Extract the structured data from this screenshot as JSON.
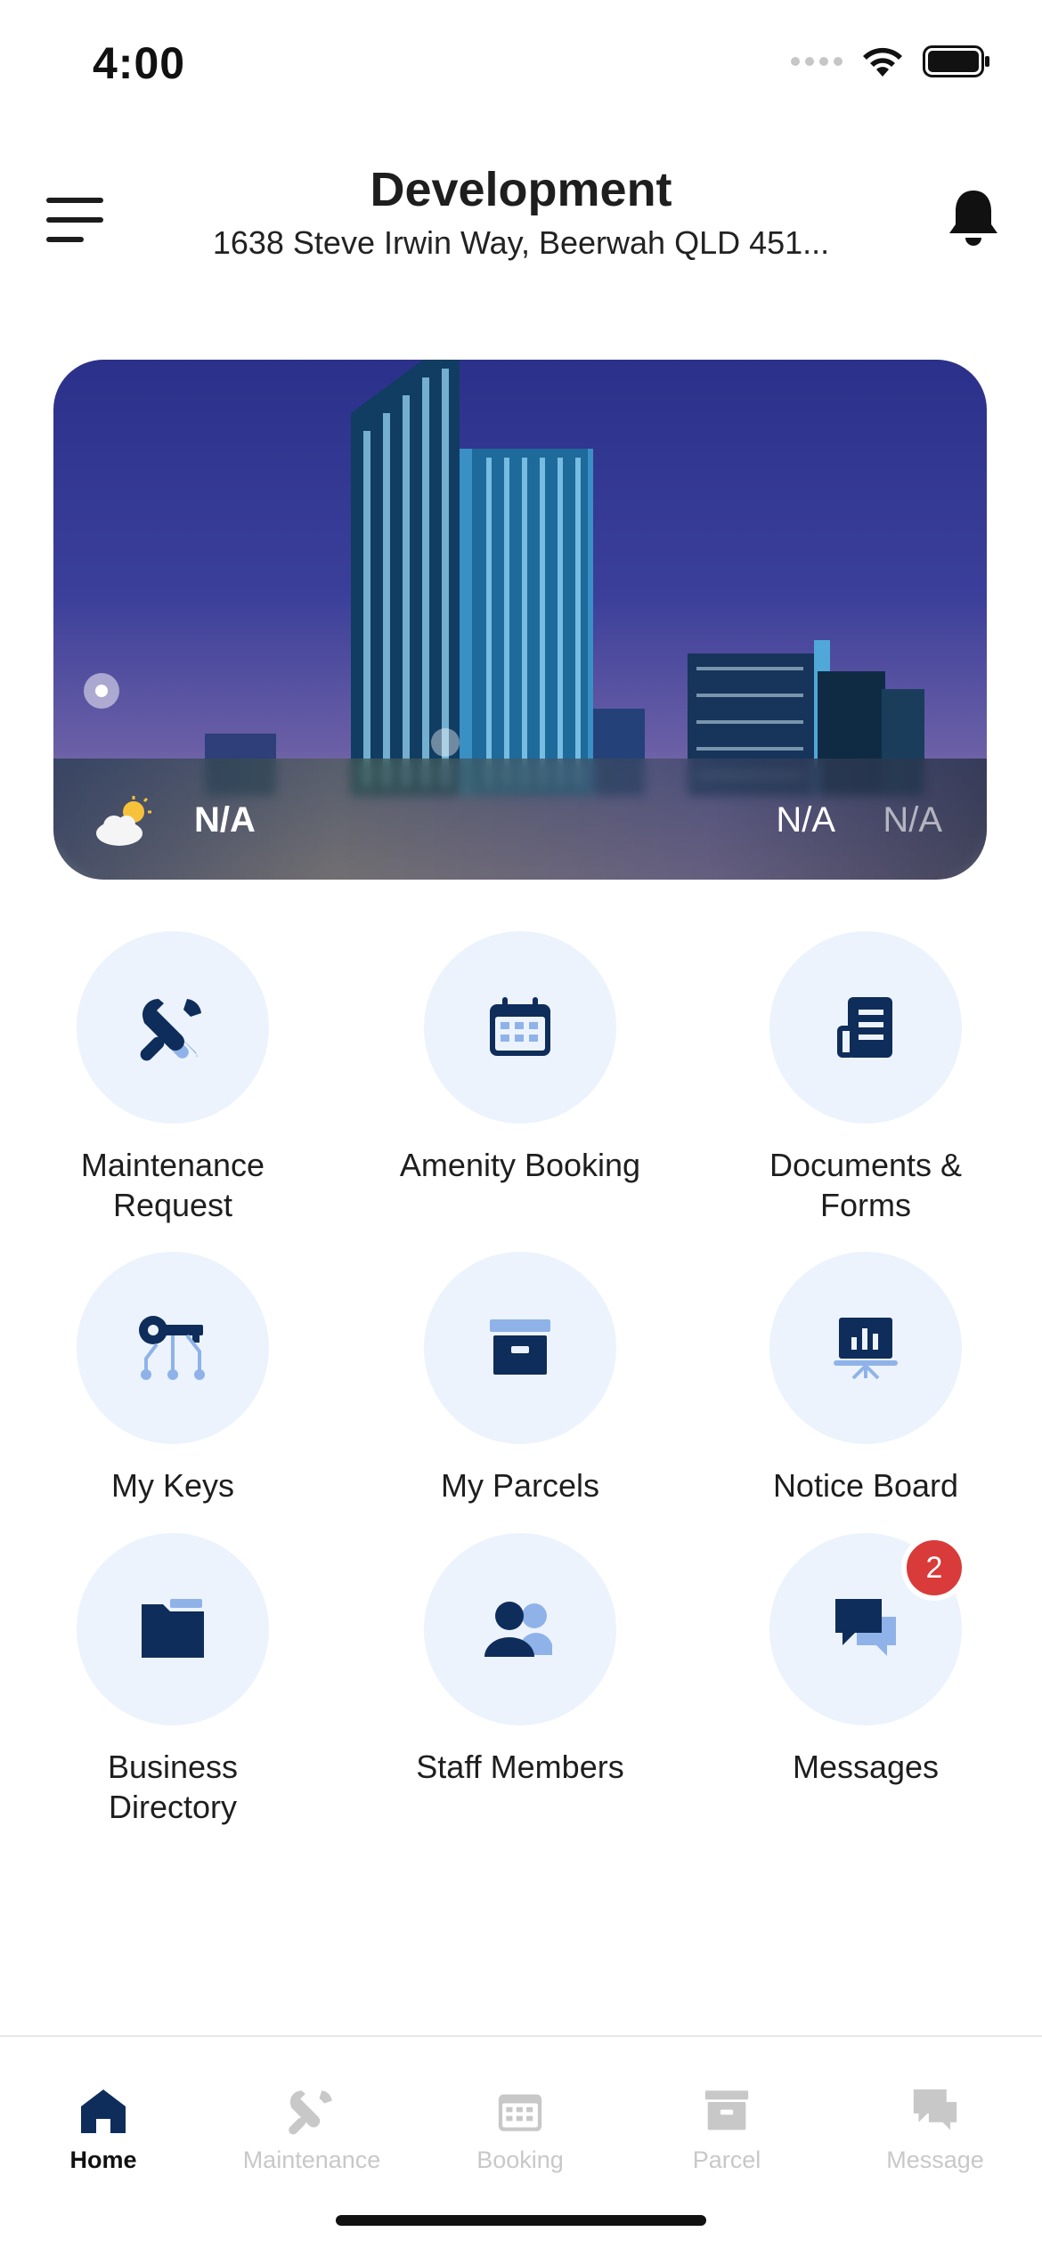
{
  "status_bar": {
    "time": "4:00"
  },
  "header": {
    "title": "Development",
    "address": "1638 Steve Irwin Way, Beerwah QLD 451..."
  },
  "weather": {
    "temp": "N/A",
    "high": "N/A",
    "low": "N/A"
  },
  "grid": [
    {
      "label": "Maintenance Request",
      "icon": "wrench-icon"
    },
    {
      "label": "Amenity Booking",
      "icon": "calendar-icon"
    },
    {
      "label": "Documents & Forms",
      "icon": "document-icon"
    },
    {
      "label": "My Keys",
      "icon": "key-icon"
    },
    {
      "label": "My Parcels",
      "icon": "parcel-icon"
    },
    {
      "label": "Notice Board",
      "icon": "notice-board-icon"
    },
    {
      "label": "Business Directory",
      "icon": "folder-icon"
    },
    {
      "label": "Staff Members",
      "icon": "staff-icon"
    },
    {
      "label": "Messages",
      "icon": "messages-icon",
      "badge": "2"
    }
  ],
  "bottom_nav": [
    {
      "label": "Home",
      "icon": "home-icon",
      "active": true
    },
    {
      "label": "Maintenance",
      "icon": "wrench-icon",
      "active": false
    },
    {
      "label": "Booking",
      "icon": "calendar-icon",
      "active": false
    },
    {
      "label": "Parcel",
      "icon": "parcel-icon",
      "active": false
    },
    {
      "label": "Message",
      "icon": "messages-icon",
      "active": false
    }
  ],
  "colors": {
    "primary": "#0f2d5a",
    "accent_light": "#8fb3e8",
    "tile_bg": "#ecf3fd",
    "badge": "#d93a3a",
    "inactive": "#c8c8c8"
  }
}
